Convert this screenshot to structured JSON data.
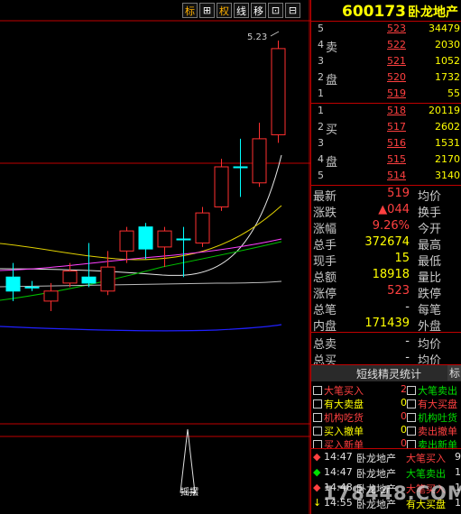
{
  "toolbar": [
    {
      "label": "标",
      "kind": "accent"
    },
    {
      "label": "⊞",
      "kind": "plain"
    },
    {
      "label": "权",
      "kind": "accent"
    },
    {
      "label": "线",
      "kind": "plain"
    },
    {
      "label": "移",
      "kind": "plain"
    },
    {
      "label": "⊡",
      "kind": "plain"
    },
    {
      "label": "⊟",
      "kind": "plain"
    }
  ],
  "stock": {
    "code": "600173",
    "name": "卧龙地产"
  },
  "chart": {
    "high_label": "5.23",
    "indicator_label": "摇摆"
  },
  "orderbook": {
    "sell_label": [
      "卖",
      "盘"
    ],
    "buy_label": [
      "买",
      "盘"
    ],
    "sell": [
      {
        "level": "5",
        "price": "523",
        "volume": "34479"
      },
      {
        "level": "4",
        "price": "522",
        "volume": "2030"
      },
      {
        "level": "3",
        "price": "521",
        "volume": "1052"
      },
      {
        "level": "2",
        "price": "520",
        "volume": "1732"
      },
      {
        "level": "1",
        "price": "519",
        "volume": "55"
      }
    ],
    "buy": [
      {
        "level": "1",
        "price": "518",
        "volume": "20119"
      },
      {
        "level": "2",
        "price": "517",
        "volume": "2602"
      },
      {
        "level": "3",
        "price": "516",
        "volume": "1531"
      },
      {
        "level": "4",
        "price": "515",
        "volume": "2170"
      },
      {
        "level": "5",
        "price": "514",
        "volume": "3140"
      }
    ]
  },
  "quote": [
    {
      "k1": "最新",
      "v1": "519",
      "c1": "red",
      "k2": "均价"
    },
    {
      "k1": "涨跌",
      "v1": "▲044",
      "c1": "red",
      "k2": "换手"
    },
    {
      "k1": "涨幅",
      "v1": "9.26%",
      "c1": "red",
      "k2": "今开"
    },
    {
      "k1": "总手",
      "v1": "372674",
      "c1": "yel",
      "k2": "最高"
    },
    {
      "k1": "现手",
      "v1": "15",
      "c1": "yel",
      "k2": "最低"
    },
    {
      "k1": "总额",
      "v1": "18918",
      "c1": "yel",
      "k2": "量比"
    },
    {
      "k1": "涨停",
      "v1": "523",
      "c1": "red",
      "k2": "跌停"
    },
    {
      "k1": "总笔",
      "v1": "-",
      "c1": "wht",
      "k2": "每笔"
    },
    {
      "k1": "内盘",
      "v1": "171439",
      "c1": "yel",
      "k2": "外盘"
    },
    {
      "k1": "总卖",
      "v1": "-",
      "c1": "wht",
      "k2": "均价"
    },
    {
      "k1": "总买",
      "v1": "-",
      "c1": "wht",
      "k2": "均价"
    }
  ],
  "spirit": {
    "title": "短线精灵统计",
    "btn": "标",
    "left": [
      {
        "label": "大笔买入",
        "count": "2",
        "color": "#ff4040"
      },
      {
        "label": "有大卖盘",
        "count": "0",
        "color": "#ffff00"
      },
      {
        "label": "机构吃货",
        "count": "0",
        "color": "#ff4040"
      },
      {
        "label": "买入撤单",
        "count": "0",
        "color": "#ffff00"
      },
      {
        "label": "买入新单",
        "count": "0",
        "color": "#ff4040"
      }
    ],
    "right": [
      {
        "label": "大笔卖出",
        "color": "#00e000"
      },
      {
        "label": "有大买盘",
        "color": "#ff4040"
      },
      {
        "label": "机构吐货",
        "color": "#00e000"
      },
      {
        "label": "卖出撤单",
        "color": "#ff4040"
      },
      {
        "label": "卖出新单",
        "color": "#00e000"
      }
    ]
  },
  "events": [
    {
      "sym": "◆",
      "time": "14:47",
      "name": "卧龙地产",
      "type": "大笔买入",
      "val": "9",
      "c": "#ff4040"
    },
    {
      "sym": "◆",
      "time": "14:47",
      "name": "卧龙地产",
      "type": "大笔卖出",
      "val": "1",
      "c": "#00e000"
    },
    {
      "sym": "◆",
      "time": "14:48",
      "name": "卧龙地产",
      "type": "大笔买入",
      "val": "1",
      "c": "#ff4040"
    },
    {
      "sym": "↓",
      "time": "14:55",
      "name": "卧龙地产",
      "type": "有大买盘",
      "val": "1",
      "c": "#ffff00"
    }
  ],
  "watermark": "178448.COM",
  "chart_data": {
    "type": "candlestick",
    "candles": [
      {
        "o": 4.05,
        "c": 3.98,
        "h": 4.12,
        "l": 3.93,
        "up": false
      },
      {
        "o": 4.0,
        "c": 4.0,
        "h": 4.03,
        "l": 3.98,
        "up": false
      },
      {
        "o": 3.93,
        "c": 3.98,
        "h": 4.02,
        "l": 3.88,
        "up": true
      },
      {
        "o": 4.02,
        "c": 4.08,
        "h": 4.12,
        "l": 4.0,
        "up": true
      },
      {
        "o": 4.05,
        "c": 4.02,
        "h": 4.22,
        "l": 4.0,
        "up": false
      },
      {
        "o": 3.98,
        "c": 4.1,
        "h": 4.18,
        "l": 3.96,
        "up": true
      },
      {
        "o": 4.18,
        "c": 4.28,
        "h": 4.3,
        "l": 4.12,
        "up": true
      },
      {
        "o": 4.3,
        "c": 4.19,
        "h": 4.32,
        "l": 4.14,
        "up": false
      },
      {
        "o": 4.2,
        "c": 4.28,
        "h": 4.3,
        "l": 4.1,
        "up": true
      },
      {
        "o": 4.24,
        "c": 4.24,
        "h": 4.3,
        "l": 4.05,
        "up": true
      },
      {
        "o": 4.22,
        "c": 4.37,
        "h": 4.4,
        "l": 4.2,
        "up": true
      },
      {
        "o": 4.4,
        "c": 4.6,
        "h": 4.64,
        "l": 4.38,
        "up": true
      },
      {
        "o": 4.6,
        "c": 4.6,
        "h": 4.74,
        "l": 4.45,
        "up": false
      },
      {
        "o": 4.52,
        "c": 4.74,
        "h": 4.82,
        "l": 4.5,
        "up": true
      },
      {
        "o": 4.76,
        "c": 5.19,
        "h": 5.23,
        "l": 4.72,
        "up": true
      }
    ],
    "high": 5.23
  }
}
